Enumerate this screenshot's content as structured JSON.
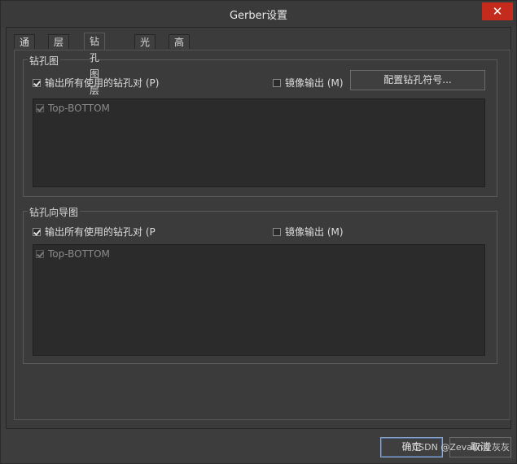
{
  "window": {
    "title": "Gerber设置",
    "close_glyph": "✕"
  },
  "tabs": [
    {
      "label": "通用"
    },
    {
      "label": "层"
    },
    {
      "label": "钻孔图层"
    },
    {
      "label": "光圈"
    },
    {
      "label": "高级"
    }
  ],
  "drill_drawing": {
    "group_label": "钻孔图",
    "plot_all_label": "输出所有使用的钻孔对 (P)",
    "plot_all_checked": true,
    "mirror_label": "镜像输出 (M)",
    "mirror_checked": false,
    "config_button": "配置钻孔符号...",
    "items": [
      {
        "label": "Top-BOTTOM",
        "checked": true
      }
    ]
  },
  "drill_guide": {
    "group_label": "钻孔向导图",
    "plot_all_label": "输出所有使用的钻孔对 (P",
    "plot_all_checked": true,
    "mirror_label": "镜像输出 (M)",
    "mirror_checked": false,
    "items": [
      {
        "label": "Top-BOTTOM",
        "checked": true
      }
    ]
  },
  "footer": {
    "ok_label": "确定",
    "cancel_label": "取消"
  },
  "watermark": "CSDN @Zevalin爱灰灰"
}
